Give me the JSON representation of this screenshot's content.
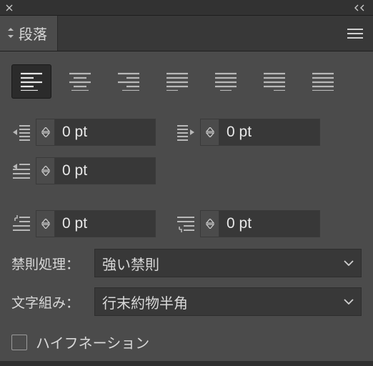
{
  "panel": {
    "tab_label": "段落"
  },
  "alignment": {
    "options": [
      "left",
      "center",
      "right",
      "justify-left",
      "justify-center",
      "justify-right",
      "justify-all"
    ],
    "active": "left"
  },
  "indents": {
    "left": "0 pt",
    "right": "0 pt",
    "first_line": "0 pt"
  },
  "spacing": {
    "before": "0 pt",
    "after": "0 pt"
  },
  "kinsoku": {
    "label": "禁則処理：",
    "value": "強い禁則"
  },
  "mojikumi": {
    "label": "文字組み：",
    "value": "行末約物半角"
  },
  "hyphenation": {
    "label": "ハイフネーション",
    "checked": false
  }
}
